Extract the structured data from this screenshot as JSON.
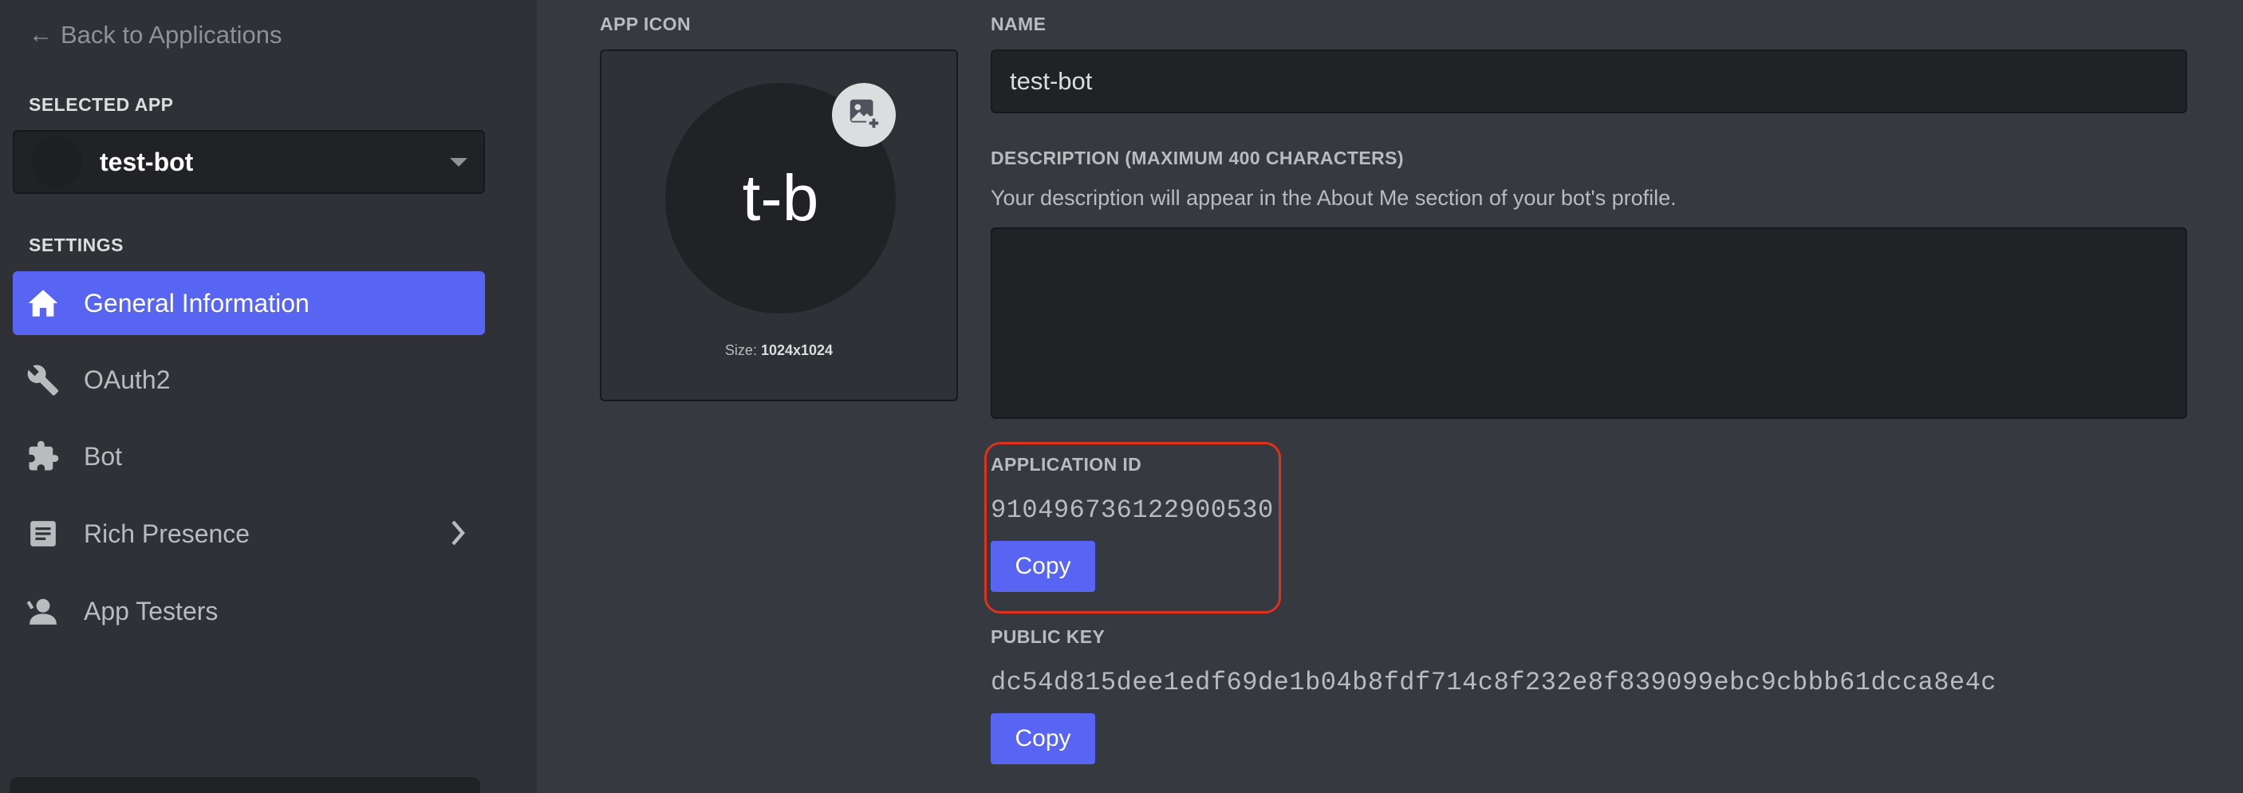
{
  "sidebar": {
    "back_label": "Back to Applications",
    "selected_app_heading": "SELECTED APP",
    "selected_app_name": "test-bot",
    "settings_heading": "SETTINGS",
    "items": [
      {
        "label": "General Information",
        "icon": "home-icon",
        "active": true
      },
      {
        "label": "OAuth2",
        "icon": "wrench-icon",
        "active": false
      },
      {
        "label": "Bot",
        "icon": "puzzle-icon",
        "active": false
      },
      {
        "label": "Rich Presence",
        "icon": "document-icon",
        "active": false
      },
      {
        "label": "App Testers",
        "icon": "person-icon",
        "active": false
      }
    ]
  },
  "main": {
    "app_icon_label": "APP ICON",
    "icon_initials": "t-b",
    "icon_size_prefix": "Size:",
    "icon_size_value": "1024x1024",
    "name_label": "NAME",
    "name_value": "test-bot",
    "description_label": "DESCRIPTION (MAXIMUM 400 CHARACTERS)",
    "description_help": "Your description will appear in the About Me section of your bot's profile.",
    "description_value": "",
    "application_id_label": "APPLICATION ID",
    "application_id_value": "910496736122900530",
    "public_key_label": "PUBLIC KEY",
    "public_key_value": "dc54d815dee1edf69de1b04b8fdf714c8f232e8f839099ebc9cbbb61dcca8e4c",
    "copy_label": "Copy"
  },
  "colors": {
    "accent": "#5865f2",
    "sidebar_bg": "#2f3136",
    "content_bg": "#36393f",
    "highlight": "#e0311f"
  }
}
